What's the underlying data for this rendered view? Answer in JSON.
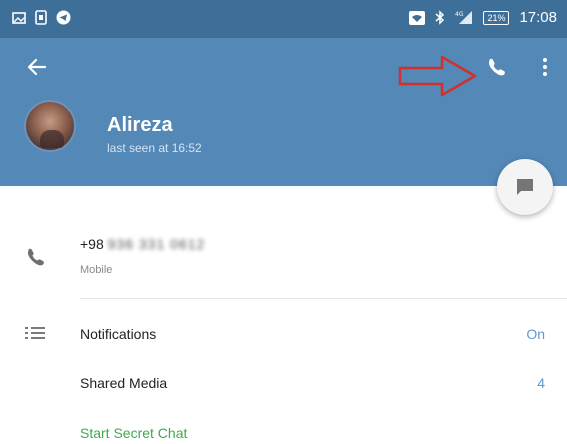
{
  "status_bar": {
    "time": "17:08",
    "battery": "21%"
  },
  "header": {
    "contact_name": "Alireza",
    "last_seen": "last seen at 16:52",
    "icons": [
      "back-arrow-icon",
      "phone-icon",
      "more-vert-icon",
      "message-icon"
    ]
  },
  "contact_info": {
    "phone_prefix": "+98",
    "phone_rest": "936 331 0612",
    "phone_label": "Mobile"
  },
  "settings": {
    "notifications_label": "Notifications",
    "notifications_value": "On",
    "shared_media_label": "Shared Media",
    "shared_media_value": "4",
    "secret_chat_label": "Start Secret Chat"
  },
  "colors": {
    "status_bar": "#3e6f98",
    "header": "#5388b7",
    "accent_value": "#5a9bd1",
    "secret_chat": "#3fa950",
    "annotation_arrow": "#d32f2f"
  }
}
